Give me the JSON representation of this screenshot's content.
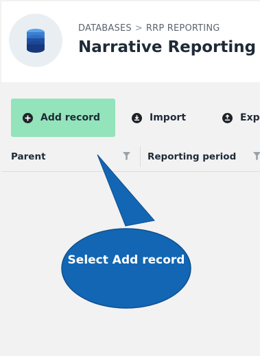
{
  "header": {
    "breadcrumb": [
      "DATABASES",
      "RRP REPORTING"
    ],
    "breadcrumb_separator": ">",
    "title": "Narrative Reporting",
    "icon": "database-icon"
  },
  "toolbar": {
    "buttons": [
      {
        "label": "Add record",
        "icon": "plus-circle-icon"
      },
      {
        "label": "Import",
        "icon": "import-icon"
      },
      {
        "label": "Exp",
        "icon": "export-icon"
      }
    ],
    "accent": "#93e3bb"
  },
  "grid": {
    "columns": [
      {
        "label": "Parent",
        "icon": "filter-icon"
      },
      {
        "label": "Reporting period",
        "icon": "filter-icon"
      }
    ],
    "rows": []
  },
  "callout": {
    "text": "Select Add record",
    "color": "#1266b4"
  }
}
